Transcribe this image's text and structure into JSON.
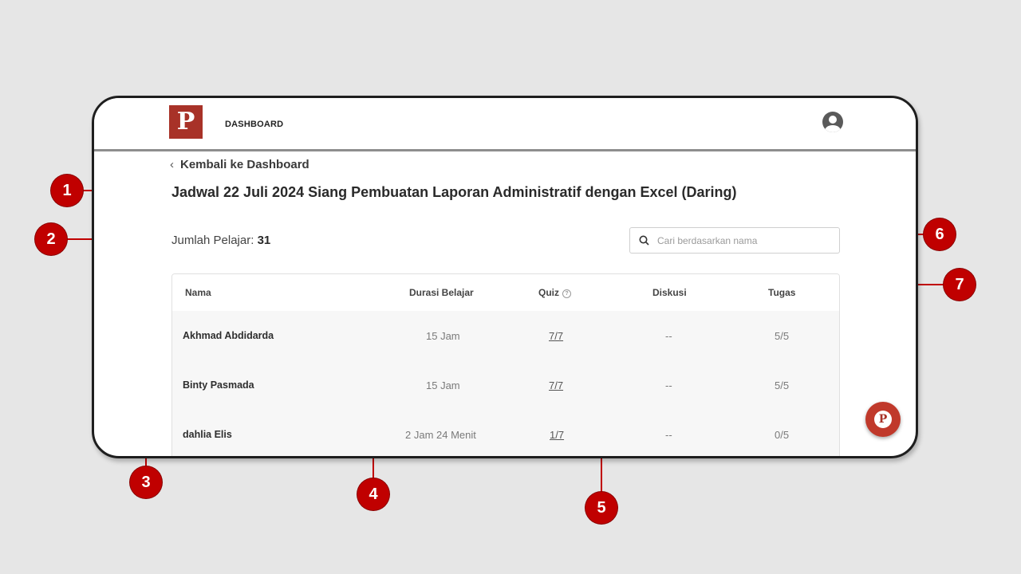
{
  "header": {
    "logo_letter": "P",
    "nav_label": "DASHBOARD"
  },
  "back_link": "Kembali ke Dashboard",
  "page_title": "Jadwal 22 Juli 2024 Siang Pembuatan Laporan Administratif dengan Excel (Daring)",
  "student_count": {
    "label": "Jumlah Pelajar: ",
    "value": "31"
  },
  "search": {
    "placeholder": "Cari berdasarkan nama"
  },
  "table": {
    "columns": [
      "Nama",
      "Durasi Belajar",
      "Quiz",
      "Diskusi",
      "Tugas"
    ],
    "rows": [
      {
        "nama": "Akhmad Abdidarda",
        "durasi": "15 Jam",
        "quiz": "7/7",
        "diskusi": "--",
        "tugas": "5/5"
      },
      {
        "nama": "Binty Pasmada",
        "durasi": "15 Jam",
        "quiz": "7/7",
        "diskusi": "--",
        "tugas": "5/5"
      },
      {
        "nama": "dahlia Elis",
        "durasi": "2 Jam 24 Menit",
        "quiz": "1/7",
        "diskusi": "--",
        "tugas": "0/5"
      }
    ]
  },
  "fab_letter": "P",
  "markers": [
    "1",
    "2",
    "3",
    "4",
    "5",
    "6",
    "7"
  ],
  "colors": {
    "brand": "#a83228",
    "marker": "#c00000",
    "background": "#e6e6e6"
  }
}
